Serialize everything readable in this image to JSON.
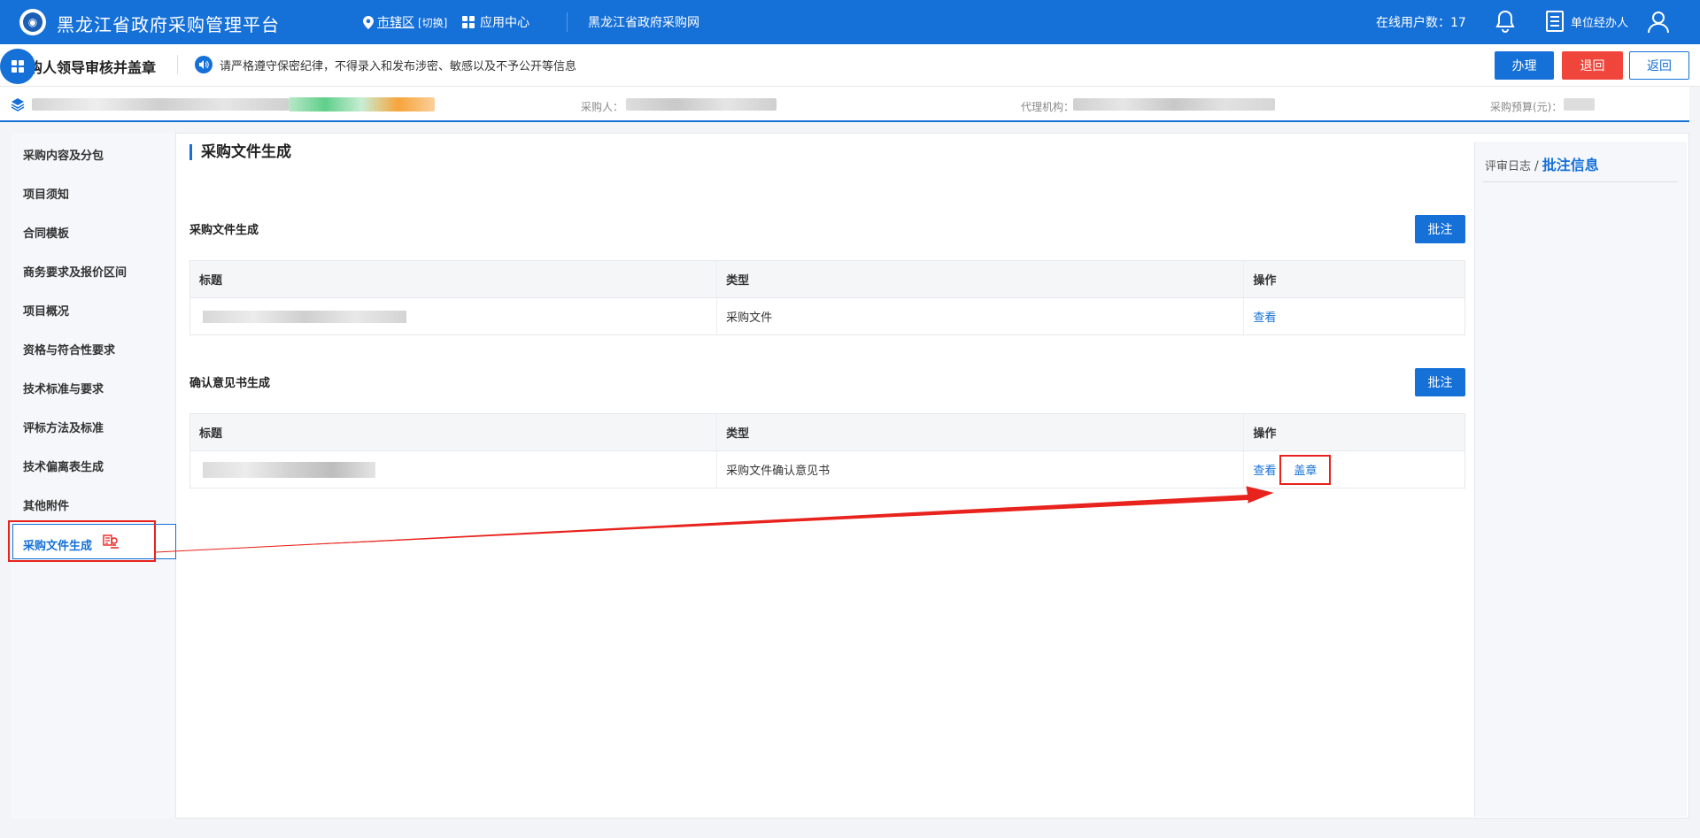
{
  "header": {
    "app_title": "黑龙江省政府采购管理平台",
    "region_name": "市辖区",
    "region_switch": "[切换]",
    "app_center": "应用中心",
    "gov_procurement_net": "黑龙江省政府采购网",
    "online_users": "在线用户数：17",
    "user_role": "单位经办人"
  },
  "subheader": {
    "page_heading": "采购人领导审核并盖章",
    "notice": "请严格遵守保密纪律，不得录入和发布涉密、敏感以及不予公开等信息",
    "buttons": {
      "handle": "办理",
      "return_back": "退回",
      "back": "返回"
    }
  },
  "infobar": {
    "purchaser_label": "采购人：",
    "agency_label": "代理机构：",
    "budget_label": "采购预算(元)："
  },
  "sidebar": {
    "items": [
      "采购内容及分包",
      "项目须知",
      "合同模板",
      "商务要求及报价区间",
      "项目概况",
      "资格与符合性要求",
      "技术标准与要求",
      "评标方法及标准",
      "技术偏离表生成",
      "其他附件",
      "采购文件生成"
    ]
  },
  "main": {
    "section_title": "采购文件生成",
    "block1": {
      "title": "采购文件生成",
      "annotate_button": "批注",
      "headers": [
        "标题",
        "类型",
        "操作"
      ],
      "row_type": "采购文件",
      "action_view": "查看"
    },
    "block2": {
      "title": "确认意见书生成",
      "annotate_button": "批注",
      "headers": [
        "标题",
        "类型",
        "操作"
      ],
      "row_type": "采购文件确认意见书",
      "action_view": "查看",
      "action_seal": "盖章"
    }
  },
  "right_panel": {
    "tab_log": "评审日志",
    "tab_slash": "/",
    "tab_info": "批注信息"
  },
  "colors": {
    "primary": "#1570d8",
    "danger": "#f0453b",
    "highlight_red": "#e8221c"
  }
}
